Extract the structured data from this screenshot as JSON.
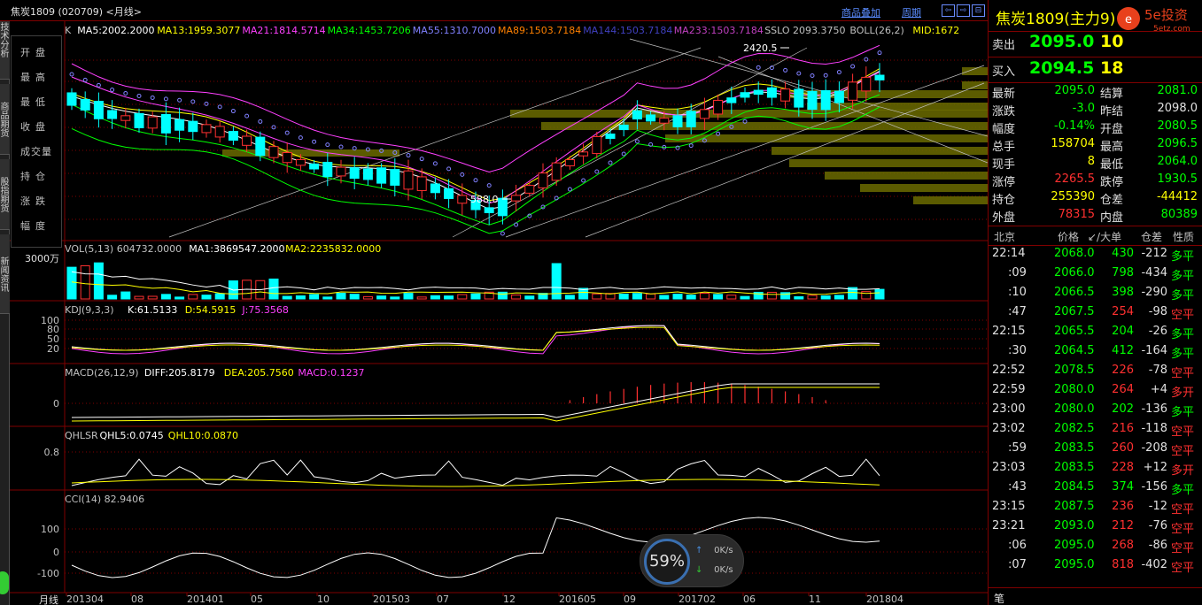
{
  "window": {
    "title": "焦炭1809 (020709) <月线>",
    "links": [
      "商品叠加",
      "周期"
    ],
    "nav_buttons": [
      "⇦",
      "⇨",
      "⊟"
    ]
  },
  "left_tabs": [
    "技术分析",
    "商品期货",
    "股指期货",
    "新闻资讯"
  ],
  "price_legend": [
    "开盘",
    "最高",
    "最低",
    "收盘",
    "成交量",
    "持仓",
    "涨跌",
    "幅度"
  ],
  "main_chart": {
    "indicator_line": [
      {
        "text": "K",
        "color": "#c0c0c0"
      },
      {
        "text": "MA5:2002.2000",
        "color": "#ffffff"
      },
      {
        "text": "MA13:1959.3077",
        "color": "#ffff00"
      },
      {
        "text": "MA21:1814.5714",
        "color": "#ff40ff"
      },
      {
        "text": "MA34:1453.7206",
        "color": "#00ff00"
      },
      {
        "text": "MA55:1310.7000",
        "color": "#8080ff"
      },
      {
        "text": "MA89:1503.7184",
        "color": "#ff8000"
      },
      {
        "text": "MA144:1503.7184",
        "color": "#4040c0"
      },
      {
        "text": "MA233:1503.7184",
        "color": "#c040c0"
      },
      {
        "text": "SSLO 2093.3750",
        "color": "#c0c0c0"
      },
      {
        "text": "BOLL(26,2)",
        "color": "#c0c0c0"
      },
      {
        "text": "MID:1672",
        "color": "#ffff00"
      }
    ],
    "high_label": "2420.5",
    "low_label": "588.0"
  },
  "vol_panel": {
    "indicator_line": [
      {
        "text": "VOL(5,13) 604732.0000",
        "color": "#c0c0c0"
      },
      {
        "text": "MA1:3869547.2000",
        "color": "#ffffff"
      },
      {
        "text": "MA2:2235832.0000",
        "color": "#ffff00"
      }
    ],
    "axis_label": "3000万"
  },
  "kdj_panel": {
    "indicator_line": [
      {
        "text": "KDJ(9,3,3)",
        "color": "#c0c0c0"
      },
      {
        "text": "K:61.5133",
        "color": "#ffffff"
      },
      {
        "text": "D:54.5915",
        "color": "#ffff00"
      },
      {
        "text": "J:75.3568",
        "color": "#ff40ff"
      }
    ],
    "ticks": [
      "100",
      "80",
      "50",
      "20"
    ]
  },
  "macd_panel": {
    "indicator_line": [
      {
        "text": "MACD(26,12,9)",
        "color": "#c0c0c0"
      },
      {
        "text": "DIFF:205.8179",
        "color": "#ffffff"
      },
      {
        "text": "DEA:205.7560",
        "color": "#ffff00"
      },
      {
        "text": "MACD:0.1237",
        "color": "#ff40ff"
      }
    ],
    "ticks": [
      "0"
    ]
  },
  "qhlsr_panel": {
    "indicator_line": [
      {
        "text": "QHLSR",
        "color": "#c0c0c0"
      },
      {
        "text": "QHL5:0.0745",
        "color": "#ffffff"
      },
      {
        "text": "QHL10:0.0870",
        "color": "#ffff00"
      }
    ],
    "ticks": [
      "0.8"
    ]
  },
  "cci_panel": {
    "indicator_line": [
      {
        "text": "CCI(14) 82.9406",
        "color": "#c0c0c0"
      }
    ],
    "ticks": [
      "100",
      "0",
      "-100"
    ]
  },
  "x_axis": {
    "period_label": "月线",
    "labels": [
      "201304",
      "08",
      "201401",
      "05",
      "10",
      "201503",
      "07",
      "12",
      "201605",
      "09",
      "201702",
      "06",
      "11",
      "201804"
    ]
  },
  "quote": {
    "name": "焦炭1809(主力9)",
    "logo_text": "5e投资",
    "logo_sub": "5etz.com",
    "ask": {
      "label": "卖出",
      "price": "2095.0",
      "qty": "10"
    },
    "bid": {
      "label": "买入",
      "price": "2094.5",
      "qty": "18"
    },
    "rows": [
      {
        "l1": "最新",
        "v1": "2095.0",
        "c1": "g",
        "l2": "结算",
        "v2": "2081.0",
        "c2": "g"
      },
      {
        "l1": "涨跌",
        "v1": "-3.0",
        "c1": "g",
        "l2": "昨结",
        "v2": "2098.0",
        "c2": "w"
      },
      {
        "l1": "幅度",
        "v1": "-0.14%",
        "c1": "g",
        "l2": "开盘",
        "v2": "2080.5",
        "c2": "g"
      },
      {
        "l1": "总手",
        "v1": "158704",
        "c1": "y",
        "l2": "最高",
        "v2": "2096.5",
        "c2": "g"
      },
      {
        "l1": "现手",
        "v1": "8",
        "c1": "y",
        "l2": "最低",
        "v2": "2064.0",
        "c2": "g"
      },
      {
        "l1": "涨停",
        "v1": "2265.5",
        "c1": "r",
        "l2": "跌停",
        "v2": "1930.5",
        "c2": "g"
      },
      {
        "l1": "持仓",
        "v1": "255390",
        "c1": "y",
        "l2": "仓差",
        "v2": "-44412",
        "c2": "y"
      },
      {
        "l1": "外盘",
        "v1": "78315",
        "c1": "r",
        "l2": "内盘",
        "v2": "80389",
        "c2": "g"
      }
    ],
    "tick_header": [
      "北京",
      "价格",
      "↙/大单",
      "仓差",
      "性质"
    ],
    "ticks": [
      {
        "time": "22:14",
        "price": "2068.0",
        "vol": "430",
        "vc": "g",
        "oi": "-212",
        "nature": "多平",
        "nc": "g"
      },
      {
        "time": ":09",
        "price": "2066.0",
        "vol": "798",
        "vc": "g",
        "oi": "-434",
        "nature": "多平",
        "nc": "g"
      },
      {
        "time": ":10",
        "price": "2066.5",
        "vol": "398",
        "vc": "g",
        "oi": "-290",
        "nature": "多平",
        "nc": "g"
      },
      {
        "time": ":47",
        "price": "2067.5",
        "vol": "254",
        "vc": "r",
        "oi": "-98",
        "nature": "空平",
        "nc": "r"
      },
      {
        "time": "22:15",
        "price": "2065.5",
        "vol": "204",
        "vc": "g",
        "oi": "-26",
        "nature": "多平",
        "nc": "g"
      },
      {
        "time": ":30",
        "price": "2064.5",
        "vol": "412",
        "vc": "g",
        "oi": "-164",
        "nature": "多平",
        "nc": "g"
      },
      {
        "time": "22:52",
        "price": "2078.5",
        "vol": "226",
        "vc": "r",
        "oi": "-78",
        "nature": "空平",
        "nc": "r"
      },
      {
        "time": "22:59",
        "price": "2080.0",
        "vol": "264",
        "vc": "r",
        "oi": "+4",
        "nature": "多开",
        "nc": "r"
      },
      {
        "time": "23:00",
        "price": "2080.0",
        "vol": "202",
        "vc": "g",
        "oi": "-136",
        "nature": "多平",
        "nc": "g"
      },
      {
        "time": "23:02",
        "price": "2082.5",
        "vol": "216",
        "vc": "r",
        "oi": "-118",
        "nature": "空平",
        "nc": "r"
      },
      {
        "time": ":59",
        "price": "2083.5",
        "vol": "260",
        "vc": "r",
        "oi": "-208",
        "nature": "空平",
        "nc": "r"
      },
      {
        "time": "23:03",
        "price": "2083.5",
        "vol": "228",
        "vc": "r",
        "oi": "+12",
        "nature": "多开",
        "nc": "r"
      },
      {
        "time": ":43",
        "price": "2084.5",
        "vol": "374",
        "vc": "g",
        "oi": "-156",
        "nature": "多平",
        "nc": "g"
      },
      {
        "time": "23:15",
        "price": "2087.5",
        "vol": "236",
        "vc": "r",
        "oi": "-12",
        "nature": "空平",
        "nc": "r"
      },
      {
        "time": "23:21",
        "price": "2093.0",
        "vol": "212",
        "vc": "r",
        "oi": "-76",
        "nature": "空平",
        "nc": "r"
      },
      {
        "time": ":06",
        "price": "2095.0",
        "vol": "268",
        "vc": "r",
        "oi": "-86",
        "nature": "空平",
        "nc": "r"
      },
      {
        "time": ":07",
        "price": "2095.0",
        "vol": "818",
        "vc": "r",
        "oi": "-402",
        "nature": "空平",
        "nc": "r"
      }
    ],
    "bottom_tab": "笔"
  },
  "speed_widget": {
    "percent": "59%",
    "up": "0K/s",
    "down": "0K/s"
  },
  "colors": {
    "up": "#ff3030",
    "down": "#00ffff",
    "grid": "#800000",
    "accent": "#ffff00"
  }
}
